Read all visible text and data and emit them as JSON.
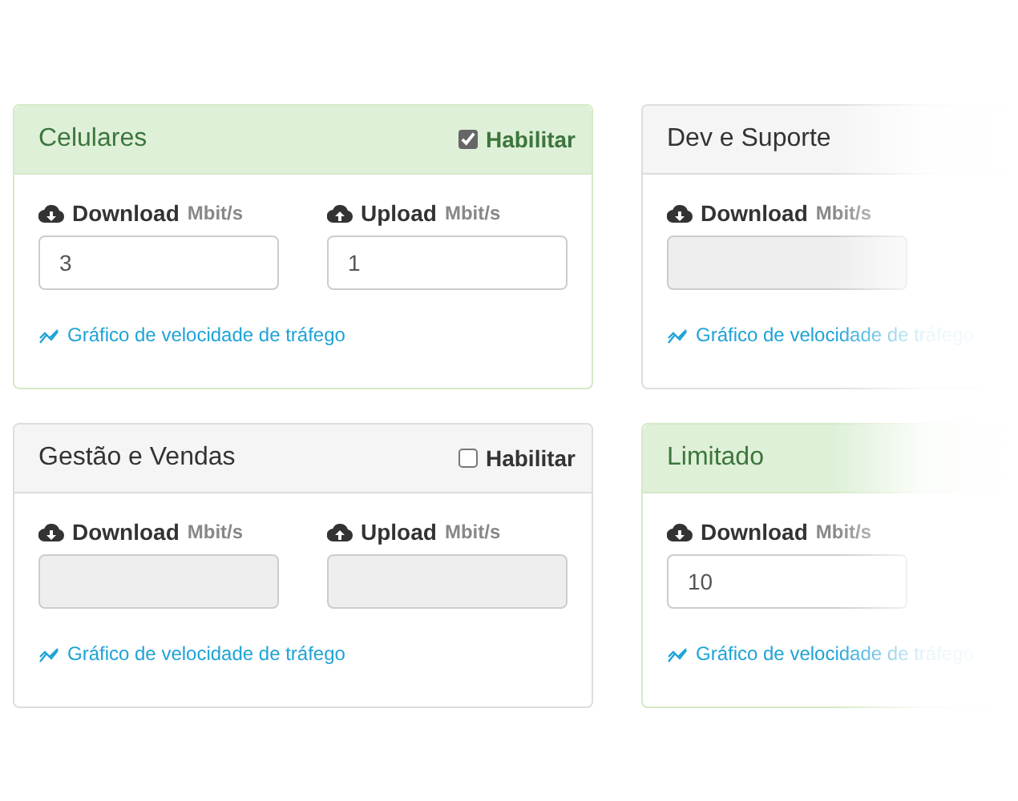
{
  "panels": [
    {
      "title": "Celulares",
      "enabled": true,
      "toggle": {
        "label": "Habilitar",
        "checked": true
      },
      "fields": [
        {
          "kind": "download",
          "label": "Download",
          "unit": "Mbit/s",
          "value": "3"
        },
        {
          "kind": "upload",
          "label": "Upload",
          "unit": "Mbit/s",
          "value": "1"
        }
      ],
      "link": "Gráfico de velocidade de tráfego"
    },
    {
      "title": "Dev e Suporte",
      "enabled": false,
      "fields": [
        {
          "kind": "download",
          "label": "Download",
          "unit": "Mbit/s"
        }
      ],
      "link": "Gráfico de velocidade de tráfego"
    },
    {
      "title": "Gestão e Vendas",
      "enabled": false,
      "toggle": {
        "label": "Habilitar",
        "checked": false
      },
      "fields": [
        {
          "kind": "download",
          "label": "Download",
          "unit": "Mbit/s"
        },
        {
          "kind": "upload",
          "label": "Upload",
          "unit": "Mbit/s"
        }
      ],
      "link": "Gráfico de velocidade de tráfego"
    },
    {
      "title": "Limitado",
      "enabled": true,
      "fields": [
        {
          "kind": "download",
          "label": "Download",
          "unit": "Mbit/s",
          "value": "10"
        }
      ],
      "link": "Gráfico de velocidade de tráfego"
    }
  ]
}
